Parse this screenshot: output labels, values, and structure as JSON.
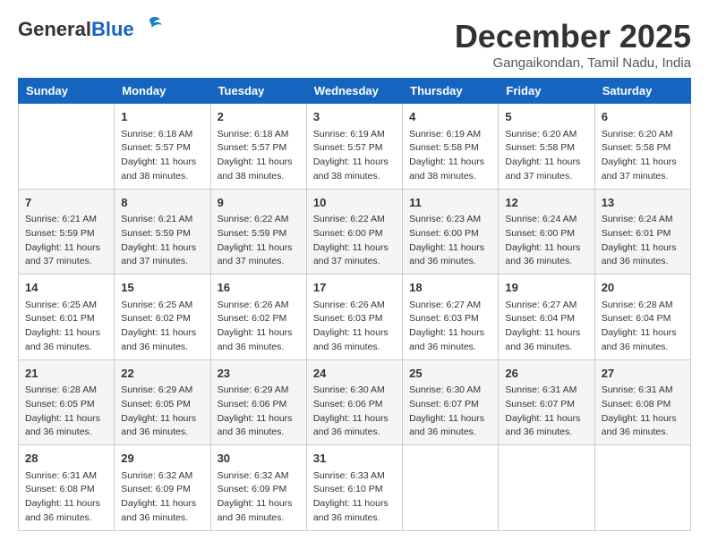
{
  "header": {
    "logo_general": "General",
    "logo_blue": "Blue",
    "month_title": "December 2025",
    "location": "Gangaikondan, Tamil Nadu, India"
  },
  "days_of_week": [
    "Sunday",
    "Monday",
    "Tuesday",
    "Wednesday",
    "Thursday",
    "Friday",
    "Saturday"
  ],
  "weeks": [
    [
      {
        "day": "",
        "info": ""
      },
      {
        "day": "1",
        "info": "Sunrise: 6:18 AM\nSunset: 5:57 PM\nDaylight: 11 hours\nand 38 minutes."
      },
      {
        "day": "2",
        "info": "Sunrise: 6:18 AM\nSunset: 5:57 PM\nDaylight: 11 hours\nand 38 minutes."
      },
      {
        "day": "3",
        "info": "Sunrise: 6:19 AM\nSunset: 5:57 PM\nDaylight: 11 hours\nand 38 minutes."
      },
      {
        "day": "4",
        "info": "Sunrise: 6:19 AM\nSunset: 5:58 PM\nDaylight: 11 hours\nand 38 minutes."
      },
      {
        "day": "5",
        "info": "Sunrise: 6:20 AM\nSunset: 5:58 PM\nDaylight: 11 hours\nand 37 minutes."
      },
      {
        "day": "6",
        "info": "Sunrise: 6:20 AM\nSunset: 5:58 PM\nDaylight: 11 hours\nand 37 minutes."
      }
    ],
    [
      {
        "day": "7",
        "info": "Sunrise: 6:21 AM\nSunset: 5:59 PM\nDaylight: 11 hours\nand 37 minutes."
      },
      {
        "day": "8",
        "info": "Sunrise: 6:21 AM\nSunset: 5:59 PM\nDaylight: 11 hours\nand 37 minutes."
      },
      {
        "day": "9",
        "info": "Sunrise: 6:22 AM\nSunset: 5:59 PM\nDaylight: 11 hours\nand 37 minutes."
      },
      {
        "day": "10",
        "info": "Sunrise: 6:22 AM\nSunset: 6:00 PM\nDaylight: 11 hours\nand 37 minutes."
      },
      {
        "day": "11",
        "info": "Sunrise: 6:23 AM\nSunset: 6:00 PM\nDaylight: 11 hours\nand 36 minutes."
      },
      {
        "day": "12",
        "info": "Sunrise: 6:24 AM\nSunset: 6:00 PM\nDaylight: 11 hours\nand 36 minutes."
      },
      {
        "day": "13",
        "info": "Sunrise: 6:24 AM\nSunset: 6:01 PM\nDaylight: 11 hours\nand 36 minutes."
      }
    ],
    [
      {
        "day": "14",
        "info": "Sunrise: 6:25 AM\nSunset: 6:01 PM\nDaylight: 11 hours\nand 36 minutes."
      },
      {
        "day": "15",
        "info": "Sunrise: 6:25 AM\nSunset: 6:02 PM\nDaylight: 11 hours\nand 36 minutes."
      },
      {
        "day": "16",
        "info": "Sunrise: 6:26 AM\nSunset: 6:02 PM\nDaylight: 11 hours\nand 36 minutes."
      },
      {
        "day": "17",
        "info": "Sunrise: 6:26 AM\nSunset: 6:03 PM\nDaylight: 11 hours\nand 36 minutes."
      },
      {
        "day": "18",
        "info": "Sunrise: 6:27 AM\nSunset: 6:03 PM\nDaylight: 11 hours\nand 36 minutes."
      },
      {
        "day": "19",
        "info": "Sunrise: 6:27 AM\nSunset: 6:04 PM\nDaylight: 11 hours\nand 36 minutes."
      },
      {
        "day": "20",
        "info": "Sunrise: 6:28 AM\nSunset: 6:04 PM\nDaylight: 11 hours\nand 36 minutes."
      }
    ],
    [
      {
        "day": "21",
        "info": "Sunrise: 6:28 AM\nSunset: 6:05 PM\nDaylight: 11 hours\nand 36 minutes."
      },
      {
        "day": "22",
        "info": "Sunrise: 6:29 AM\nSunset: 6:05 PM\nDaylight: 11 hours\nand 36 minutes."
      },
      {
        "day": "23",
        "info": "Sunrise: 6:29 AM\nSunset: 6:06 PM\nDaylight: 11 hours\nand 36 minutes."
      },
      {
        "day": "24",
        "info": "Sunrise: 6:30 AM\nSunset: 6:06 PM\nDaylight: 11 hours\nand 36 minutes."
      },
      {
        "day": "25",
        "info": "Sunrise: 6:30 AM\nSunset: 6:07 PM\nDaylight: 11 hours\nand 36 minutes."
      },
      {
        "day": "26",
        "info": "Sunrise: 6:31 AM\nSunset: 6:07 PM\nDaylight: 11 hours\nand 36 minutes."
      },
      {
        "day": "27",
        "info": "Sunrise: 6:31 AM\nSunset: 6:08 PM\nDaylight: 11 hours\nand 36 minutes."
      }
    ],
    [
      {
        "day": "28",
        "info": "Sunrise: 6:31 AM\nSunset: 6:08 PM\nDaylight: 11 hours\nand 36 minutes."
      },
      {
        "day": "29",
        "info": "Sunrise: 6:32 AM\nSunset: 6:09 PM\nDaylight: 11 hours\nand 36 minutes."
      },
      {
        "day": "30",
        "info": "Sunrise: 6:32 AM\nSunset: 6:09 PM\nDaylight: 11 hours\nand 36 minutes."
      },
      {
        "day": "31",
        "info": "Sunrise: 6:33 AM\nSunset: 6:10 PM\nDaylight: 11 hours\nand 36 minutes."
      },
      {
        "day": "",
        "info": ""
      },
      {
        "day": "",
        "info": ""
      },
      {
        "day": "",
        "info": ""
      }
    ]
  ]
}
